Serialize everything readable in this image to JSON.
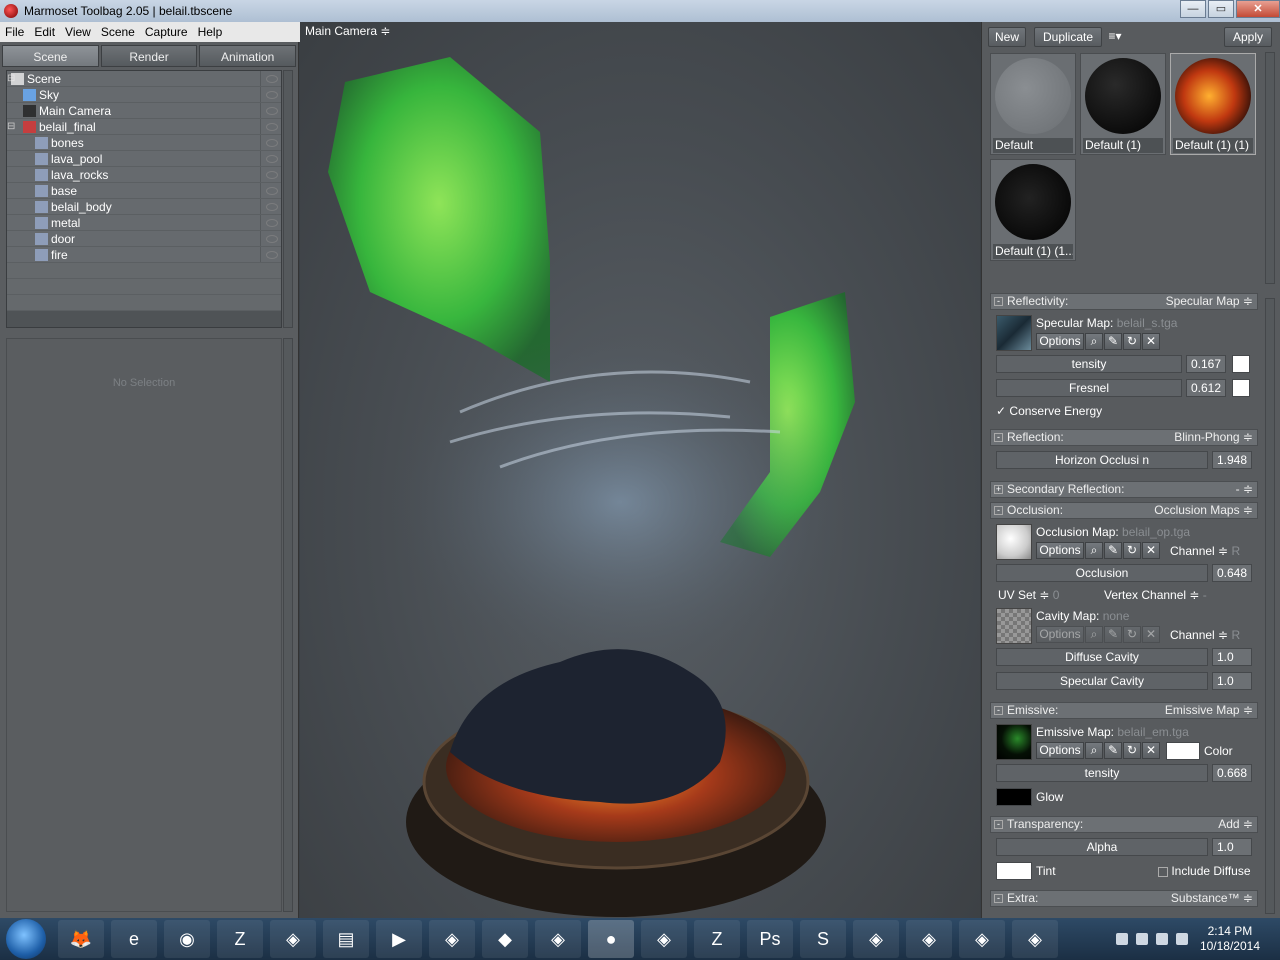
{
  "window": {
    "title": "Marmoset Toolbag 2.05  |  belail.tbscene"
  },
  "menu": [
    "File",
    "Edit",
    "View",
    "Scene",
    "Capture",
    "Help"
  ],
  "tabs": [
    "Scene",
    "Render",
    "Animation"
  ],
  "tree": [
    {
      "label": "Scene",
      "icon": "document-icon",
      "indent": 0,
      "expander": "⊟"
    },
    {
      "label": "Sky",
      "icon": "sky-icon",
      "indent": 1
    },
    {
      "label": "Main Camera",
      "icon": "camera-icon",
      "indent": 1
    },
    {
      "label": "belail_final",
      "icon": "model-icon",
      "indent": 1,
      "expander": "⊟"
    },
    {
      "label": "bones",
      "icon": "mesh-icon",
      "indent": 2
    },
    {
      "label": "lava_pool",
      "icon": "mesh-icon",
      "indent": 2
    },
    {
      "label": "lava_rocks",
      "icon": "mesh-icon",
      "indent": 2
    },
    {
      "label": "base",
      "icon": "mesh-icon",
      "indent": 2
    },
    {
      "label": "belail_body",
      "icon": "mesh-icon",
      "indent": 2
    },
    {
      "label": "metal",
      "icon": "mesh-icon",
      "indent": 2
    },
    {
      "label": "door",
      "icon": "mesh-icon",
      "indent": 2
    },
    {
      "label": "fire",
      "icon": "mesh-icon",
      "indent": 2
    }
  ],
  "props": {
    "empty": "No Selection"
  },
  "viewport": {
    "camera": "Main Camera ≑"
  },
  "toolbar": {
    "new": "New",
    "duplicate": "Duplicate",
    "menu": "≡▾",
    "apply": "Apply"
  },
  "materials": [
    "Default",
    "Default (1)",
    "Default (1) (1)",
    "Default (1) (1..."
  ],
  "reflectivity": {
    "title": "Reflectivity:",
    "mode": "Specular Map ≑",
    "map_label": "Specular Map:",
    "map_file": "belail_s.tga",
    "options": "Options",
    "intensity_label": "tensity",
    "intensity": "0.167",
    "fresnel_label": "Fresnel",
    "fresnel": "0.612",
    "conserve": "Conserve Energy",
    "check": "✓"
  },
  "reflection": {
    "title": "Reflection:",
    "mode": "Blinn-Phong ≑",
    "horizon_label": "Horizon Occlusi  n",
    "horizon": "1.948"
  },
  "secondary": {
    "title": "Secondary Reflection:",
    "mode": "- ≑"
  },
  "occlusion": {
    "title": "Occlusion:",
    "mode": "Occlusion Maps ≑",
    "map_label": "Occlusion Map:",
    "map_file": "belail_op.tga",
    "options": "Options",
    "channel": "Channel ≑",
    "channel_val": "R",
    "occ_label": "Occlusion",
    "occ": "0.648",
    "uvset": "UV Set ≑",
    "uvset_val": "0",
    "vertex": "Vertex Channel ≑",
    "vertex_val": "-",
    "cavity_label": "Cavity Map:",
    "cavity_file": "none",
    "cavity_options": "Options",
    "cavity_channel": "Channel ≑",
    "cavity_channel_val": "R",
    "diffuse_cavity_label": "Diffuse Cavity",
    "diffuse_cavity": "1.0",
    "specular_cavity_label": "Specular Cavity",
    "specular_cavity": "1.0"
  },
  "emissive": {
    "title": "Emissive:",
    "mode": "Emissive Map ≑",
    "map_label": "Emissive Map:",
    "map_file": "belail_em.tga",
    "options": "Options",
    "color_label": "Color",
    "intensity_label": "tensity",
    "intensity": "0.668",
    "glow_label": "Glow"
  },
  "transparency": {
    "title": "Transparency:",
    "mode": "Add ≑",
    "alpha_label": "Alpha",
    "alpha": "1.0",
    "tint_label": "Tint",
    "include": "Include Diffuse"
  },
  "extra": {
    "title": "Extra:",
    "mode": "Substance™ ≑"
  },
  "taskbar": {
    "apps": [
      "firefox-icon",
      "ie-icon",
      "chrome-icon",
      "filezilla-icon",
      "app-icon",
      "explorer-icon",
      "media-icon",
      "app-icon",
      "dropbox-icon",
      "app-icon",
      "marmoset-icon",
      "app-icon",
      "zbrush-icon",
      "photoshop-icon",
      "substance-icon",
      "app-icon",
      "app-icon",
      "app-icon",
      "app-icon"
    ],
    "time": "2:14 PM",
    "date": "10/18/2014"
  }
}
